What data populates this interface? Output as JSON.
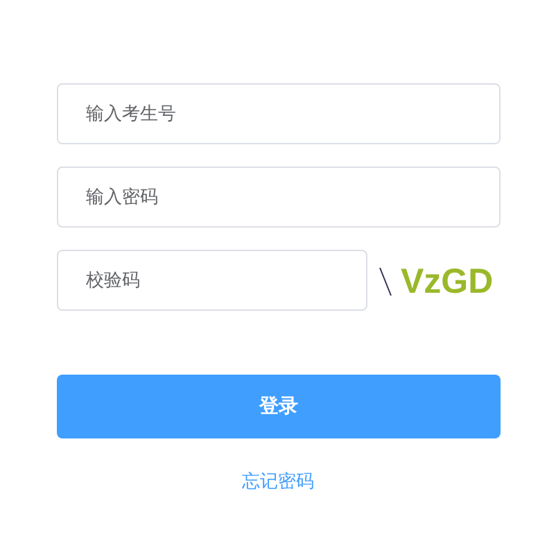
{
  "fields": [
    {
      "placeholder": "输入考生号"
    },
    {
      "placeholder": "输入密码"
    }
  ],
  "captcha": {
    "placeholder": "校验码",
    "code": "VzGD"
  },
  "login_button": "登录",
  "forgot_link": "忘记密码"
}
